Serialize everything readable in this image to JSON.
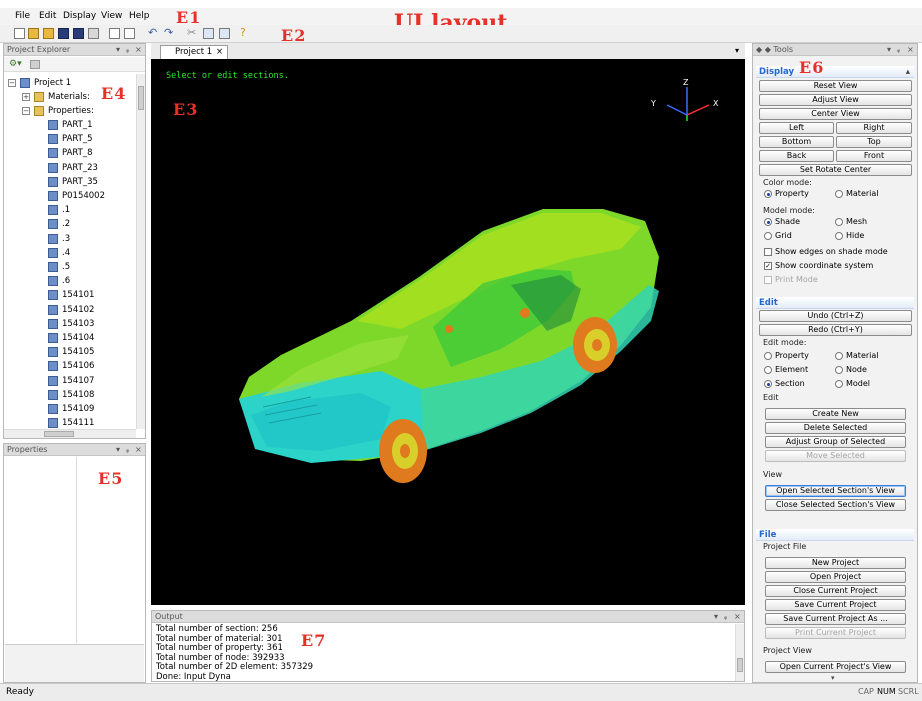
{
  "annotation": {
    "title": "UI layout",
    "labels": {
      "e1": "E1",
      "e2": "E2",
      "e3": "E3",
      "e4": "E4",
      "e5": "E5",
      "e6": "E6",
      "e7": "E7"
    }
  },
  "menu": [
    "File",
    "Edit",
    "Display",
    "View",
    "Help"
  ],
  "explorer": {
    "title": "Project Explorer",
    "project": "Project 1",
    "materials": "Materials:",
    "properties": "Properties:",
    "parts": [
      "PART_1",
      "PART_5",
      "PART_8",
      "PART_23",
      "PART_35",
      "P0154002",
      ".1",
      ".2",
      ".3",
      ".4",
      ".5",
      ".6",
      "154101",
      "154102",
      "154103",
      "154104",
      "154105",
      "154106",
      "154107",
      "154108",
      "154109",
      "154111"
    ]
  },
  "properties_panel": {
    "title": "Properties"
  },
  "viewport": {
    "tab": "Project 1",
    "message": "Select or edit sections.",
    "axes": {
      "x": "X",
      "y": "Y",
      "z": "Z"
    }
  },
  "tools": {
    "title": "Tools",
    "display": {
      "header": "Display",
      "reset": "Reset View",
      "adjust": "Adjust View",
      "center": "Center View",
      "left": "Left",
      "right": "Right",
      "bottom": "Bottom",
      "top": "Top",
      "back": "Back",
      "front": "Front",
      "rotate": "Set Rotate Center",
      "color_mode": "Color mode:",
      "color_property": "Property",
      "color_material": "Material",
      "model_mode": "Model mode:",
      "shade": "Shade",
      "mesh": "Mesh",
      "grid": "Grid",
      "hide": "Hide",
      "show_edges": "Show edges on shade mode",
      "show_coord": "Show coordinate system",
      "print_mode": "Print Mode"
    },
    "edit": {
      "header": "Edit",
      "undo": "Undo (Ctrl+Z)",
      "redo": "Redo (Ctrl+Y)",
      "edit_mode": "Edit mode:",
      "property": "Property",
      "material": "Material",
      "element": "Element",
      "node": "Node",
      "section": "Section",
      "model": "Model",
      "edit_group": "Edit",
      "create": "Create New",
      "delete": "Delete Selected",
      "adjust_group": "Adjust Group of Selected",
      "move": "Move Selected",
      "view_group": "View",
      "open_section": "Open Selected Section's View",
      "close_section": "Close Selected Section's View"
    },
    "file": {
      "header": "File",
      "project_file": "Project File",
      "new_project": "New Project",
      "open_project": "Open Project",
      "close_project": "Close Current Project",
      "save_project": "Save Current Project",
      "save_as": "Save Current Project As ...",
      "print_project": "Print Current Project",
      "project_view": "Project View",
      "open_view": "Open Current Project's View"
    }
  },
  "output": {
    "title": "Output",
    "lines": [
      "Total number of section: 256",
      "Total number of material: 301",
      "Total number of property: 361",
      "Total number of node: 392933",
      "Total number of 2D element: 357329",
      "Done: Input Dyna"
    ]
  },
  "status": {
    "text": "Ready",
    "cap": "CAP",
    "num": "NUM",
    "scrl": "SCRL"
  },
  "colors": {
    "body": "#7ed82a",
    "lower": "#2bd3c8",
    "tire": "#e07a1e",
    "rim": "#d9cf2a",
    "message": "#2ee82e",
    "accent": "#2566d0"
  }
}
